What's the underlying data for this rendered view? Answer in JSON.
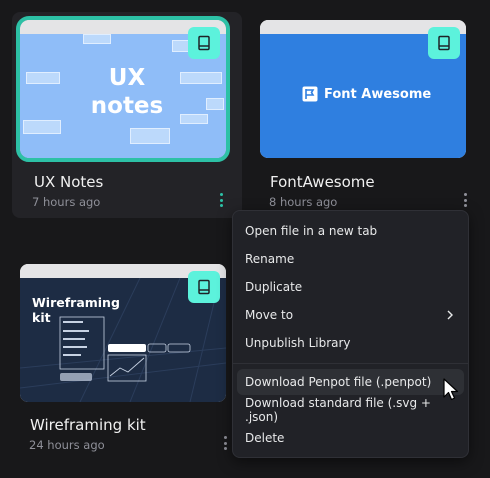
{
  "files": [
    {
      "title": "UX Notes",
      "time": "7 hours ago",
      "thumb_text_1": "UX",
      "thumb_text_2": "notes"
    },
    {
      "title": "FontAwesome",
      "time": "8 hours ago",
      "thumb_text": "Font Awesome"
    },
    {
      "title": "Wireframing kit",
      "time": "24 hours ago",
      "thumb_text_1": "Wireframing",
      "thumb_text_2": "kit"
    }
  ],
  "menu": {
    "items": [
      "Open file in a new tab",
      "Rename",
      "Duplicate",
      "Move to",
      "Unpublish Library",
      "Download Penpot file (.penpot)",
      "Download standard file (.svg + .json)",
      "Delete"
    ]
  },
  "colors": {
    "accent": "#2dc1a6",
    "library_badge": "#5cf2dc",
    "background": "#18181a",
    "menu_bg": "#212227"
  },
  "icons": {
    "library_badge": "book-icon",
    "more": "kebab-icon",
    "submenu": "chevron-right-icon",
    "pointer": "cursor-arrow-icon"
  }
}
